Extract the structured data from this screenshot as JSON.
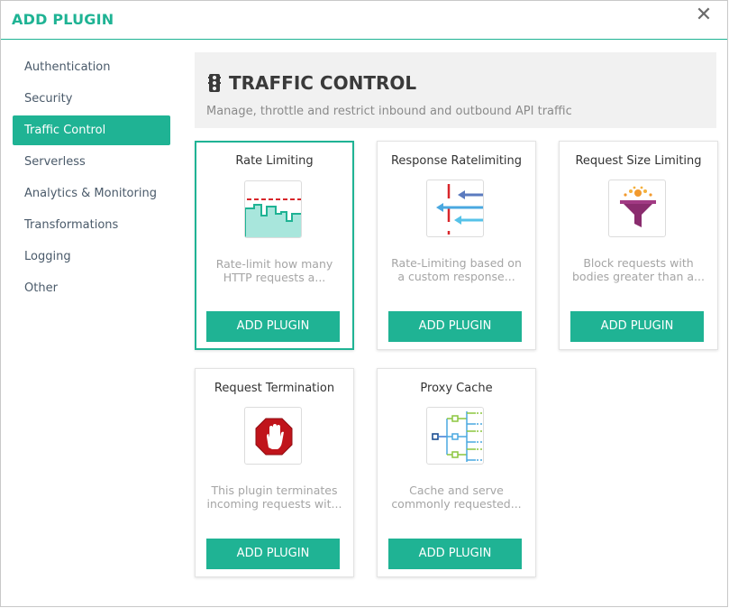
{
  "header": {
    "title": "ADD PLUGIN",
    "close_icon": "close-icon"
  },
  "sidebar": {
    "items": [
      {
        "label": "Authentication"
      },
      {
        "label": "Security"
      },
      {
        "label": "Traffic Control",
        "active": true
      },
      {
        "label": "Serverless"
      },
      {
        "label": "Analytics & Monitoring"
      },
      {
        "label": "Transformations"
      },
      {
        "label": "Logging"
      },
      {
        "label": "Other"
      }
    ]
  },
  "category": {
    "title": "TRAFFIC CONTROL",
    "icon": "traffic-light-icon",
    "description": "Manage, throttle and restrict inbound and outbound API traffic"
  },
  "plugins": [
    {
      "title": "Rate Limiting",
      "description": "Rate-limit how many HTTP requests a...",
      "button": "ADD PLUGIN",
      "icon": "rate-limiting-icon",
      "selected": true
    },
    {
      "title": "Response Ratelimiting",
      "description": "Rate-Limiting based on a custom response...",
      "button": "ADD PLUGIN",
      "icon": "response-ratelimiting-icon"
    },
    {
      "title": "Request Size Limiting",
      "description": "Block requests with bodies greater than a...",
      "button": "ADD PLUGIN",
      "icon": "funnel-icon"
    },
    {
      "title": "Request Termination",
      "description": "This plugin terminates incoming requests wit...",
      "button": "ADD PLUGIN",
      "icon": "stop-hand-icon"
    },
    {
      "title": "Proxy Cache",
      "description": "Cache and serve commonly requested...",
      "button": "ADD PLUGIN",
      "icon": "proxy-cache-icon"
    }
  ],
  "colors": {
    "accent": "#1fb394",
    "stop_red": "#c0141b",
    "funnel_purple": "#8a2c6e"
  }
}
